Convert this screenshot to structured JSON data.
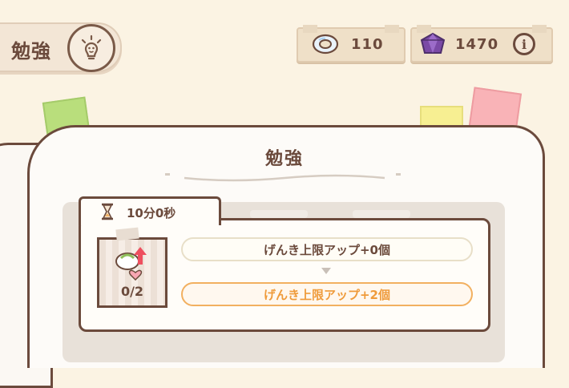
{
  "header": {
    "title": "勉強",
    "title_icon": "lightbulb-face-icon"
  },
  "resources": {
    "rings": {
      "icon": "ring-icon",
      "value": "110"
    },
    "gems": {
      "icon": "purple-gem-icon",
      "value": "1470"
    },
    "info_icon": "info-icon"
  },
  "notebook": {
    "heading": "勉強"
  },
  "study": {
    "timer_icon": "hourglass-icon",
    "time": "10分0秒",
    "item_icon": "stamina-up-item-icon",
    "item_count": "0/2",
    "current_effect": "げんき上限アップ+0個",
    "next_effect": "げんき上限アップ+2個"
  },
  "colors": {
    "background": "#fbf3e3",
    "outline": "#6b4a3c",
    "accent_orange": "#ef9b3b",
    "tab_green": "#b9de7c",
    "tab_yellow": "#f7ef92",
    "tab_pink": "#f9b3b7",
    "gem_purple": "#7b4aa6"
  }
}
